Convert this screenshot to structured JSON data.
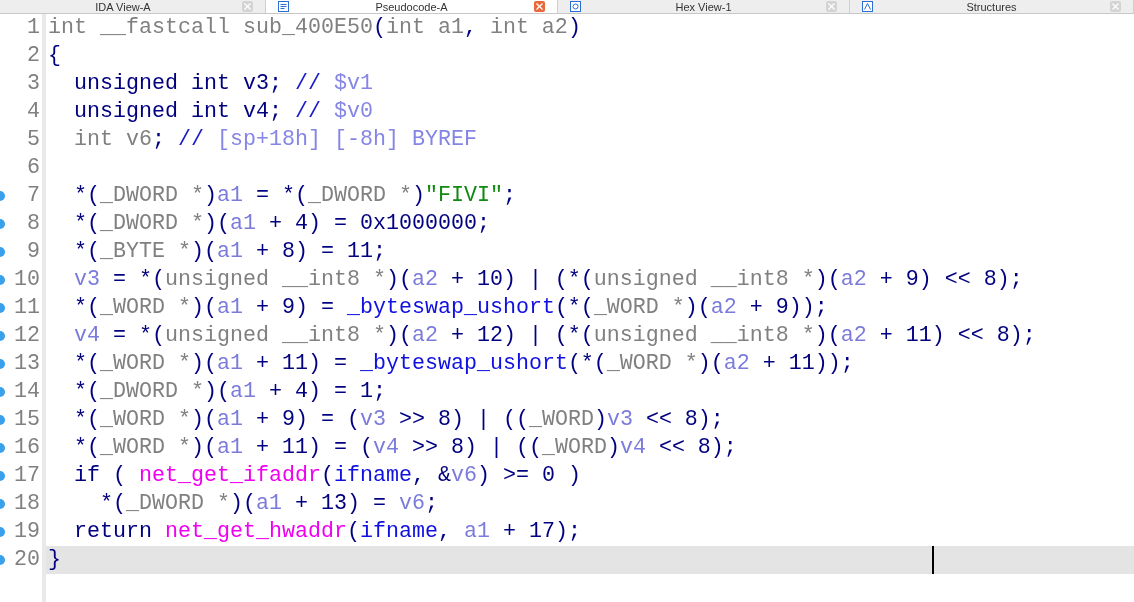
{
  "tabs": [
    {
      "label": "IDA View-A",
      "selected": false
    },
    {
      "label": "Pseudocode-A",
      "selected": true
    },
    {
      "label": "Hex View-1",
      "selected": false
    },
    {
      "label": "Structures",
      "selected": false
    }
  ],
  "lines": [
    {
      "number": "1",
      "marker": false,
      "selected": false,
      "tokens": [
        {
          "text": "int __fastcall sub_400E50",
          "kind": "type"
        },
        {
          "text": "(",
          "kind": "keyword"
        },
        {
          "text": "int a1",
          "kind": "type"
        },
        {
          "text": ", ",
          "kind": "keyword"
        },
        {
          "text": "int a2",
          "kind": "type"
        },
        {
          "text": ")",
          "kind": "keyword"
        }
      ]
    },
    {
      "number": "2",
      "marker": false,
      "selected": false,
      "tokens": [
        {
          "text": "{",
          "kind": "keyword"
        }
      ]
    },
    {
      "number": "3",
      "marker": false,
      "selected": false,
      "tokens": [
        {
          "text": "  unsigned int v3; ",
          "kind": "keyword"
        },
        {
          "text": "// ",
          "kind": "comment"
        },
        {
          "text": "$v1",
          "kind": "annotation"
        }
      ]
    },
    {
      "number": "4",
      "marker": false,
      "selected": false,
      "tokens": [
        {
          "text": "  unsigned int v4; ",
          "kind": "keyword"
        },
        {
          "text": "// ",
          "kind": "comment"
        },
        {
          "text": "$v0",
          "kind": "annotation"
        }
      ]
    },
    {
      "number": "5",
      "marker": false,
      "selected": false,
      "tokens": [
        {
          "text": "  int v6",
          "kind": "type"
        },
        {
          "text": "; ",
          "kind": "keyword"
        },
        {
          "text": "// ",
          "kind": "comment"
        },
        {
          "text": "[sp+18h] [-8h] BYREF",
          "kind": "annotation"
        }
      ]
    },
    {
      "number": "6",
      "marker": false,
      "selected": false
    },
    {
      "number": "7",
      "marker": true,
      "selected": false,
      "tokens": [
        {
          "text": "  *(",
          "kind": "keyword"
        },
        {
          "text": "_DWORD *",
          "kind": "type"
        },
        {
          "text": ")",
          "kind": "keyword"
        },
        {
          "text": "a1",
          "kind": "variable"
        },
        {
          "text": " = *(",
          "kind": "keyword"
        },
        {
          "text": "_DWORD *",
          "kind": "type"
        },
        {
          "text": ")",
          "kind": "keyword"
        },
        {
          "text": "\"FIVI\"",
          "kind": "string"
        },
        {
          "text": ";",
          "kind": "keyword"
        }
      ]
    },
    {
      "number": "8",
      "marker": true,
      "selected": false,
      "tokens": [
        {
          "text": "  *(",
          "kind": "keyword"
        },
        {
          "text": "_DWORD *",
          "kind": "type"
        },
        {
          "text": ")(",
          "kind": "keyword"
        },
        {
          "text": "a1",
          "kind": "variable"
        },
        {
          "text": " + 4) = 0x1000000;",
          "kind": "keyword"
        }
      ]
    },
    {
      "number": "9",
      "marker": true,
      "selected": false,
      "tokens": [
        {
          "text": "  *(",
          "kind": "keyword"
        },
        {
          "text": "_BYTE *",
          "kind": "type"
        },
        {
          "text": ")(",
          "kind": "keyword"
        },
        {
          "text": "a1",
          "kind": "variable"
        },
        {
          "text": " + 8) = 11;",
          "kind": "keyword"
        }
      ]
    },
    {
      "number": "10",
      "marker": true,
      "selected": false,
      "tokens": [
        {
          "text": "  v3",
          "kind": "variable"
        },
        {
          "text": " = *(",
          "kind": "keyword"
        },
        {
          "text": "unsigned __int8 *",
          "kind": "type"
        },
        {
          "text": ")(",
          "kind": "keyword"
        },
        {
          "text": "a2",
          "kind": "variable"
        },
        {
          "text": " + 10) | (*(",
          "kind": "keyword"
        },
        {
          "text": "unsigned __int8 *",
          "kind": "type"
        },
        {
          "text": ")(",
          "kind": "keyword"
        },
        {
          "text": "a2",
          "kind": "variable"
        },
        {
          "text": " + 9) << 8);",
          "kind": "keyword"
        }
      ]
    },
    {
      "number": "11",
      "marker": true,
      "selected": false,
      "tokens": [
        {
          "text": "  *(",
          "kind": "keyword"
        },
        {
          "text": "_WORD *",
          "kind": "type"
        },
        {
          "text": ")(",
          "kind": "keyword"
        },
        {
          "text": "a1",
          "kind": "variable"
        },
        {
          "text": " + 9) = ",
          "kind": "keyword"
        },
        {
          "text": "_byteswap_ushort",
          "kind": "function"
        },
        {
          "text": "(*(",
          "kind": "keyword"
        },
        {
          "text": "_WORD *",
          "kind": "type"
        },
        {
          "text": ")(",
          "kind": "keyword"
        },
        {
          "text": "a2",
          "kind": "variable"
        },
        {
          "text": " + 9));",
          "kind": "keyword"
        }
      ]
    },
    {
      "number": "12",
      "marker": true,
      "selected": false,
      "tokens": [
        {
          "text": "  v4",
          "kind": "variable"
        },
        {
          "text": " = *(",
          "kind": "keyword"
        },
        {
          "text": "unsigned __int8 *",
          "kind": "type"
        },
        {
          "text": ")(",
          "kind": "keyword"
        },
        {
          "text": "a2",
          "kind": "variable"
        },
        {
          "text": " + 12) | (*(",
          "kind": "keyword"
        },
        {
          "text": "unsigned __int8 *",
          "kind": "type"
        },
        {
          "text": ")(",
          "kind": "keyword"
        },
        {
          "text": "a2",
          "kind": "variable"
        },
        {
          "text": " + 11) << 8);",
          "kind": "keyword"
        }
      ]
    },
    {
      "number": "13",
      "marker": true,
      "selected": false,
      "tokens": [
        {
          "text": "  *(",
          "kind": "keyword"
        },
        {
          "text": "_WORD *",
          "kind": "type"
        },
        {
          "text": ")(",
          "kind": "keyword"
        },
        {
          "text": "a1",
          "kind": "variable"
        },
        {
          "text": " + 11) = ",
          "kind": "keyword"
        },
        {
          "text": "_byteswap_ushort",
          "kind": "function"
        },
        {
          "text": "(*(",
          "kind": "keyword"
        },
        {
          "text": "_WORD *",
          "kind": "type"
        },
        {
          "text": ")(",
          "kind": "keyword"
        },
        {
          "text": "a2",
          "kind": "variable"
        },
        {
          "text": " + 11));",
          "kind": "keyword"
        }
      ]
    },
    {
      "number": "14",
      "marker": true,
      "selected": false,
      "tokens": [
        {
          "text": "  *(",
          "kind": "keyword"
        },
        {
          "text": "_DWORD *",
          "kind": "type"
        },
        {
          "text": ")(",
          "kind": "keyword"
        },
        {
          "text": "a1",
          "kind": "variable"
        },
        {
          "text": " + 4) = 1;",
          "kind": "keyword"
        }
      ]
    },
    {
      "number": "15",
      "marker": true,
      "selected": false,
      "tokens": [
        {
          "text": "  *(",
          "kind": "keyword"
        },
        {
          "text": "_WORD *",
          "kind": "type"
        },
        {
          "text": ")(",
          "kind": "keyword"
        },
        {
          "text": "a1",
          "kind": "variable"
        },
        {
          "text": " + 9) = (",
          "kind": "keyword"
        },
        {
          "text": "v3",
          "kind": "variable"
        },
        {
          "text": " >> 8) | ((",
          "kind": "keyword"
        },
        {
          "text": "_WORD",
          "kind": "type"
        },
        {
          "text": ")",
          "kind": "keyword"
        },
        {
          "text": "v3",
          "kind": "variable"
        },
        {
          "text": " << 8);",
          "kind": "keyword"
        }
      ]
    },
    {
      "number": "16",
      "marker": true,
      "selected": false,
      "tokens": [
        {
          "text": "  *(",
          "kind": "keyword"
        },
        {
          "text": "_WORD *",
          "kind": "type"
        },
        {
          "text": ")(",
          "kind": "keyword"
        },
        {
          "text": "a1",
          "kind": "variable"
        },
        {
          "text": " + 11) = (",
          "kind": "keyword"
        },
        {
          "text": "v4",
          "kind": "variable"
        },
        {
          "text": " >> 8) | ((",
          "kind": "keyword"
        },
        {
          "text": "_WORD",
          "kind": "type"
        },
        {
          "text": ")",
          "kind": "keyword"
        },
        {
          "text": "v4",
          "kind": "variable"
        },
        {
          "text": " << 8);",
          "kind": "keyword"
        }
      ]
    },
    {
      "number": "17",
      "marker": true,
      "selected": false,
      "tokens": [
        {
          "text": "  if ( ",
          "kind": "keyword"
        },
        {
          "text": "net_get_ifaddr",
          "kind": "import"
        },
        {
          "text": "(",
          "kind": "keyword"
        },
        {
          "text": "ifname",
          "kind": "function"
        },
        {
          "text": ", &",
          "kind": "keyword"
        },
        {
          "text": "v6",
          "kind": "variable"
        },
        {
          "text": ") >= 0 )",
          "kind": "keyword"
        }
      ]
    },
    {
      "number": "18",
      "marker": true,
      "selected": false,
      "tokens": [
        {
          "text": "    *(",
          "kind": "keyword"
        },
        {
          "text": "_DWORD *",
          "kind": "type"
        },
        {
          "text": ")(",
          "kind": "keyword"
        },
        {
          "text": "a1",
          "kind": "variable"
        },
        {
          "text": " + 13) = ",
          "kind": "keyword"
        },
        {
          "text": "v6",
          "kind": "variable"
        },
        {
          "text": ";",
          "kind": "keyword"
        }
      ]
    },
    {
      "number": "19",
      "marker": true,
      "selected": false,
      "tokens": [
        {
          "text": "  return ",
          "kind": "keyword"
        },
        {
          "text": "net_get_hwaddr",
          "kind": "import"
        },
        {
          "text": "(",
          "kind": "keyword"
        },
        {
          "text": "ifname",
          "kind": "function"
        },
        {
          "text": ", ",
          "kind": "keyword"
        },
        {
          "text": "a1",
          "kind": "variable"
        },
        {
          "text": " + 17);",
          "kind": "keyword"
        }
      ]
    },
    {
      "number": "20",
      "marker": true,
      "selected": true,
      "tokens": [
        {
          "text": "}",
          "kind": "keyword"
        }
      ]
    }
  ]
}
